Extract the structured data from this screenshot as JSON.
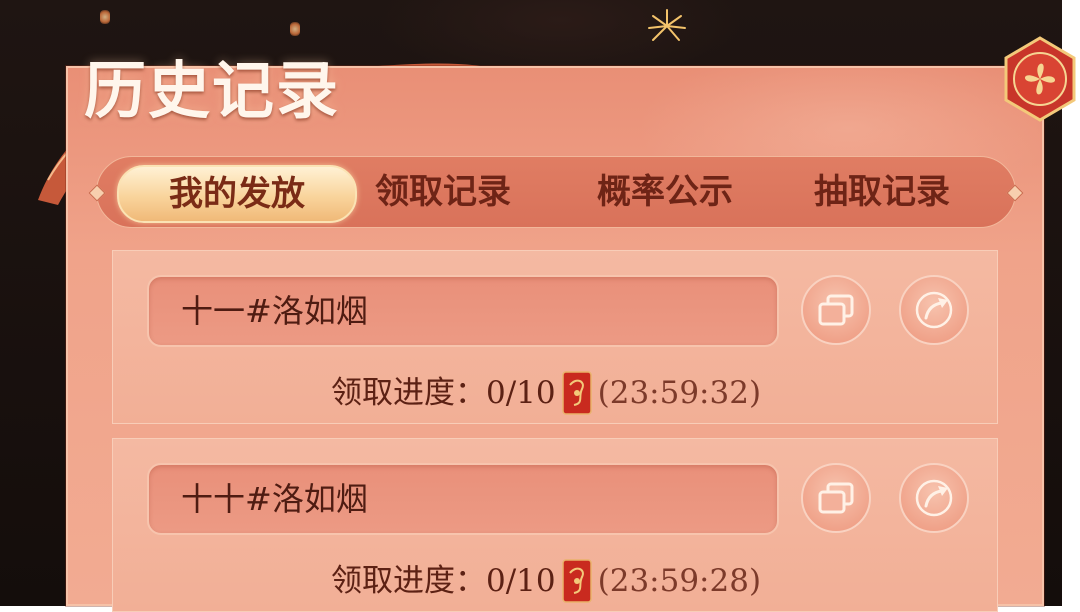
{
  "page": {
    "title": "历史记录"
  },
  "tabs": [
    {
      "label": "我的发放",
      "active": true
    },
    {
      "label": "领取记录",
      "active": false
    },
    {
      "label": "概率公示",
      "active": false
    },
    {
      "label": "抽取记录",
      "active": false
    }
  ],
  "records": [
    {
      "name": "十一#洛如烟",
      "progress_label": "领取进度：",
      "progress_value": "0/10",
      "timer": "(23:59:32)"
    },
    {
      "name": "十十#洛如烟",
      "progress_label": "领取进度：",
      "progress_value": "0/10",
      "timer": "(23:59:28)"
    }
  ],
  "icons": {
    "copy": "copy-icon",
    "share": "share-arrow-icon",
    "envelope": "red-envelope-icon",
    "close": "close-emblem-icon"
  },
  "colors": {
    "panel": "#f0a38a",
    "tab_active": "#f9d49c",
    "text_dark": "#5c2114",
    "title": "#fff6ec"
  }
}
